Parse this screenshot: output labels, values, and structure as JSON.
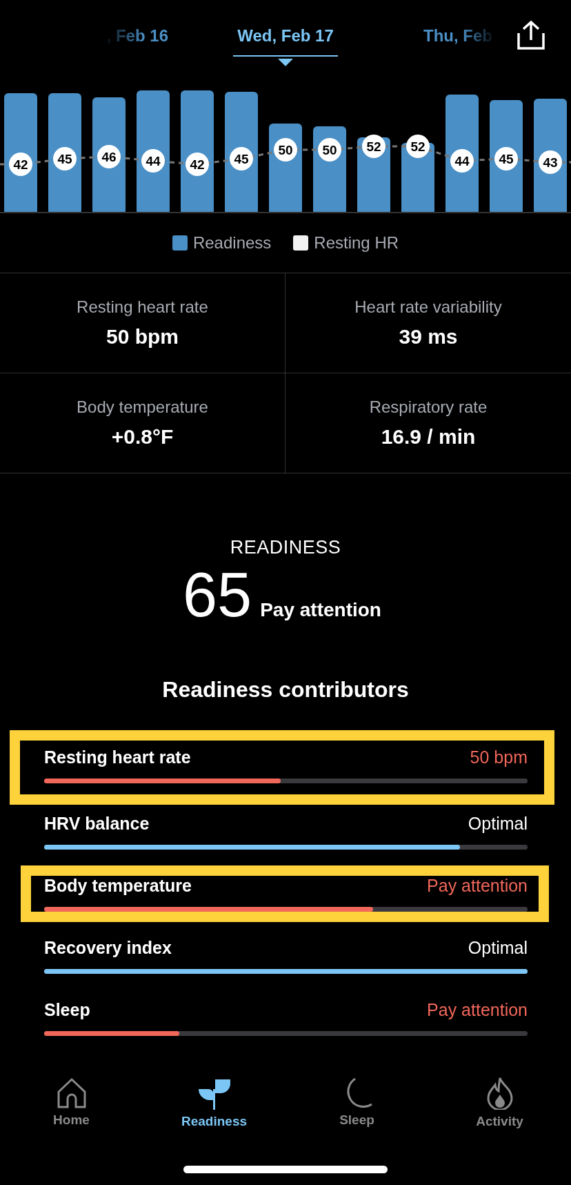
{
  "dates": [
    {
      "label": ", Feb 16",
      "selected": false
    },
    {
      "label": "Wed, Feb 17",
      "selected": true
    },
    {
      "label": "Thu, Feb",
      "selected": false
    }
  ],
  "hr_labels": [
    "42",
    "45",
    "46",
    "44",
    "42",
    "45",
    "50",
    "50",
    "52",
    "52",
    "44",
    "45",
    "43"
  ],
  "legend": [
    {
      "label": "Readiness",
      "color": "#4a8fc5"
    },
    {
      "label": "Resting HR",
      "color": "#f2f2f2"
    }
  ],
  "stats": [
    {
      "label": "Resting heart rate",
      "value": "50 bpm"
    },
    {
      "label": "Heart rate variability",
      "value": "39 ms"
    },
    {
      "label": "Body temperature",
      "value": "+0.8°F"
    },
    {
      "label": "Respiratory rate",
      "value": "16.9 / min"
    }
  ],
  "readiness": {
    "title": "READINESS",
    "score": "65",
    "status": "Pay attention"
  },
  "contributors_title": "Readiness contributors",
  "contributors": [
    {
      "name": "Resting heart rate",
      "value": "50 bpm",
      "kind": "attention",
      "level": 0.49,
      "highlighted": true
    },
    {
      "name": "HRV balance",
      "value": "Optimal",
      "kind": "optimal",
      "level": 0.86,
      "highlighted": false
    },
    {
      "name": "Body temperature",
      "value": "Pay attention",
      "kind": "attention",
      "level": 0.68,
      "highlighted": true
    },
    {
      "name": "Recovery index",
      "value": "Optimal",
      "kind": "optimal",
      "level": 1.0,
      "highlighted": false
    },
    {
      "name": "Sleep",
      "value": "Pay attention",
      "kind": "attention",
      "level": 0.28,
      "highlighted": false
    }
  ],
  "nav": [
    {
      "label": "Home",
      "kind": "home",
      "selected": false
    },
    {
      "label": "Readiness",
      "kind": "readiness",
      "selected": true
    },
    {
      "label": "Sleep",
      "kind": "sleep",
      "selected": false
    },
    {
      "label": "Activity",
      "kind": "activity",
      "selected": false
    }
  ]
}
